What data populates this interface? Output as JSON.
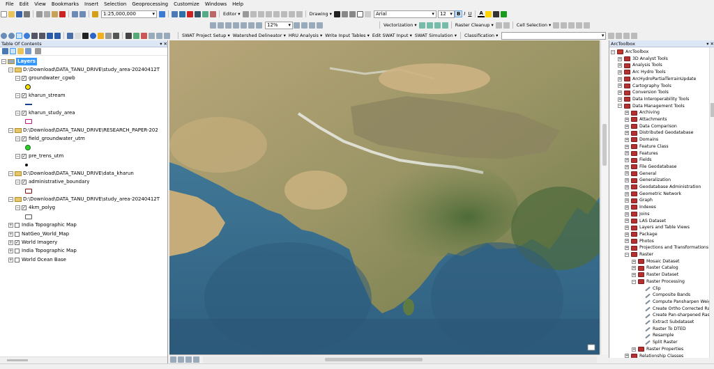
{
  "menubar": [
    "File",
    "Edit",
    "View",
    "Bookmarks",
    "Insert",
    "Selection",
    "Geoprocessing",
    "Customize",
    "Windows",
    "Help"
  ],
  "toolbar": {
    "scale": "1:25,000,000",
    "editor_label": "Editor ▾",
    "drawing_label": "Drawing ▾",
    "font_name": "Arial",
    "font_size": "12",
    "bold": "B",
    "italic": "I",
    "underline": "U",
    "font_color": "A",
    "zoom_percent": "12%",
    "vectorization_label": "Vectorization ▾",
    "raster_cleanup_label": "Raster Cleanup ▾",
    "cell_selection_label": "Cell Selection ▾",
    "classification_label": "Classification ▾"
  },
  "swat_toolbar": [
    "SWAT Project Setup ▾",
    "Watershed Delineator ▾",
    "HRU Analysis ▾",
    "Write Input Tables ▾",
    "Edit SWAT Input ▾",
    "SWAT Simulation ▾"
  ],
  "toc": {
    "title": "Table Of Contents",
    "root": "Layers",
    "rows": [
      {
        "indent": 1,
        "exp": "−",
        "chk": false,
        "folder": true,
        "label": "D:\\Download\\DATA_TANU_DRIVE\\study_area-20240412T"
      },
      {
        "indent": 2,
        "exp": "−",
        "chk": true,
        "label": "groundwater_cgwb"
      },
      {
        "indent": 3,
        "symbol": "yellow-circle"
      },
      {
        "indent": 2,
        "exp": "−",
        "chk": true,
        "label": "kharun_stream"
      },
      {
        "indent": 3,
        "symbol": "blue-line"
      },
      {
        "indent": 2,
        "exp": "−",
        "chk": true,
        "label": "kharun_study_area"
      },
      {
        "indent": 3,
        "symbol": "magenta-box"
      },
      {
        "indent": 1,
        "exp": "−",
        "chk": false,
        "folder": true,
        "label": "D:\\Download\\DATA_TANU_DRIVE\\RESEARCH_PAPER-202"
      },
      {
        "indent": 2,
        "exp": "−",
        "chk": true,
        "label": "field_groundwater_utm"
      },
      {
        "indent": 3,
        "symbol": "green-circle"
      },
      {
        "indent": 2,
        "exp": "−",
        "chk": true,
        "label": "pre_trens_utm"
      },
      {
        "indent": 3,
        "symbol": "black-dot"
      },
      {
        "indent": 1,
        "exp": "−",
        "chk": false,
        "folder": true,
        "label": "D:\\Download\\DATA_TANU_DRIVE\\data_kharun"
      },
      {
        "indent": 2,
        "exp": "−",
        "chk": true,
        "label": "administrative_boundary"
      },
      {
        "indent": 3,
        "symbol": "darkred-box"
      },
      {
        "indent": 1,
        "exp": "−",
        "chk": false,
        "folder": true,
        "label": "D:\\Download\\DATA_TANU_DRIVE\\study_area-20240412T"
      },
      {
        "indent": 2,
        "exp": "−",
        "chk": true,
        "label": "4km_polyg"
      },
      {
        "indent": 3,
        "symbol": "white-box"
      },
      {
        "indent": 1,
        "exp": "+",
        "chk": false,
        "label": "India Topographic Map"
      },
      {
        "indent": 1,
        "exp": "+",
        "chk": false,
        "label": "NatGeo_World_Map"
      },
      {
        "indent": 1,
        "exp": "+",
        "chk": true,
        "label": "World Imagery"
      },
      {
        "indent": 1,
        "exp": "+",
        "chk": false,
        "label": "India Topographic Map"
      },
      {
        "indent": 1,
        "exp": "+",
        "chk": false,
        "label": "World Ocean Base"
      }
    ]
  },
  "arctoolbox": {
    "title": "ArcToolbox",
    "rows": [
      {
        "level": 0,
        "exp": "−",
        "kind": "root",
        "label": "ArcToolbox"
      },
      {
        "level": 1,
        "exp": "+",
        "kind": "box",
        "label": "3D Analyst Tools"
      },
      {
        "level": 1,
        "exp": "+",
        "kind": "box",
        "label": "Analysis Tools"
      },
      {
        "level": 1,
        "exp": "+",
        "kind": "box",
        "label": "Arc Hydro Tools"
      },
      {
        "level": 1,
        "exp": "+",
        "kind": "box",
        "label": "ArcHydroPartialTerrainUpdate"
      },
      {
        "level": 1,
        "exp": "+",
        "kind": "box",
        "label": "Cartography Tools"
      },
      {
        "level": 1,
        "exp": "+",
        "kind": "box",
        "label": "Conversion Tools"
      },
      {
        "level": 1,
        "exp": "+",
        "kind": "box",
        "label": "Data Interoperability Tools"
      },
      {
        "level": 1,
        "exp": "−",
        "kind": "box",
        "label": "Data Management Tools"
      },
      {
        "level": 2,
        "exp": "+",
        "kind": "box",
        "label": "Archiving"
      },
      {
        "level": 2,
        "exp": "+",
        "kind": "box",
        "label": "Attachments"
      },
      {
        "level": 2,
        "exp": "+",
        "kind": "box",
        "label": "Data Comparison"
      },
      {
        "level": 2,
        "exp": "+",
        "kind": "box",
        "label": "Distributed Geodatabase"
      },
      {
        "level": 2,
        "exp": "+",
        "kind": "box",
        "label": "Domains"
      },
      {
        "level": 2,
        "exp": "+",
        "kind": "box",
        "label": "Feature Class"
      },
      {
        "level": 2,
        "exp": "+",
        "kind": "box",
        "label": "Features"
      },
      {
        "level": 2,
        "exp": "+",
        "kind": "box",
        "label": "Fields"
      },
      {
        "level": 2,
        "exp": "+",
        "kind": "box",
        "label": "File Geodatabase"
      },
      {
        "level": 2,
        "exp": "+",
        "kind": "box",
        "label": "General"
      },
      {
        "level": 2,
        "exp": "+",
        "kind": "box",
        "label": "Generalization"
      },
      {
        "level": 2,
        "exp": "+",
        "kind": "box",
        "label": "Geodatabase Administration"
      },
      {
        "level": 2,
        "exp": "+",
        "kind": "box",
        "label": "Geometric Network"
      },
      {
        "level": 2,
        "exp": "+",
        "kind": "box",
        "label": "Graph"
      },
      {
        "level": 2,
        "exp": "+",
        "kind": "box",
        "label": "Indexes"
      },
      {
        "level": 2,
        "exp": "+",
        "kind": "box",
        "label": "Joins"
      },
      {
        "level": 2,
        "exp": "+",
        "kind": "box",
        "label": "LAS Dataset"
      },
      {
        "level": 2,
        "exp": "+",
        "kind": "box",
        "label": "Layers and Table Views"
      },
      {
        "level": 2,
        "exp": "+",
        "kind": "box",
        "label": "Package"
      },
      {
        "level": 2,
        "exp": "+",
        "kind": "box",
        "label": "Photos"
      },
      {
        "level": 2,
        "exp": "+",
        "kind": "box",
        "label": "Projections and Transformations"
      },
      {
        "level": 2,
        "exp": "−",
        "kind": "box",
        "label": "Raster"
      },
      {
        "level": 3,
        "exp": "+",
        "kind": "box",
        "label": "Mosaic Dataset"
      },
      {
        "level": 3,
        "exp": "+",
        "kind": "box",
        "label": "Raster Catalog"
      },
      {
        "level": 3,
        "exp": "+",
        "kind": "box",
        "label": "Raster Dataset"
      },
      {
        "level": 3,
        "exp": "−",
        "kind": "box",
        "label": "Raster Processing"
      },
      {
        "level": 4,
        "exp": "",
        "kind": "tool",
        "label": "Clip"
      },
      {
        "level": 4,
        "exp": "",
        "kind": "tool",
        "label": "Composite Bands"
      },
      {
        "level": 4,
        "exp": "",
        "kind": "tool",
        "label": "Compute Pansharpen Weig"
      },
      {
        "level": 4,
        "exp": "",
        "kind": "tool",
        "label": "Create Ortho Corrected Ras"
      },
      {
        "level": 4,
        "exp": "",
        "kind": "tool",
        "label": "Create Pan-sharpened Raste"
      },
      {
        "level": 4,
        "exp": "",
        "kind": "tool",
        "label": "Extract Subdataset"
      },
      {
        "level": 4,
        "exp": "",
        "kind": "tool",
        "label": "Raster To DTED"
      },
      {
        "level": 4,
        "exp": "",
        "kind": "tool",
        "label": "Resample"
      },
      {
        "level": 4,
        "exp": "",
        "kind": "tool",
        "label": "Split Raster"
      },
      {
        "level": 3,
        "exp": "+",
        "kind": "box",
        "label": "Raster Properties"
      },
      {
        "level": 2,
        "exp": "+",
        "kind": "box",
        "label": "Relationship Classes"
      }
    ]
  },
  "colors": {
    "ocean": "#3f7392",
    "land": "#a89c72",
    "accent": "#3399ff"
  }
}
